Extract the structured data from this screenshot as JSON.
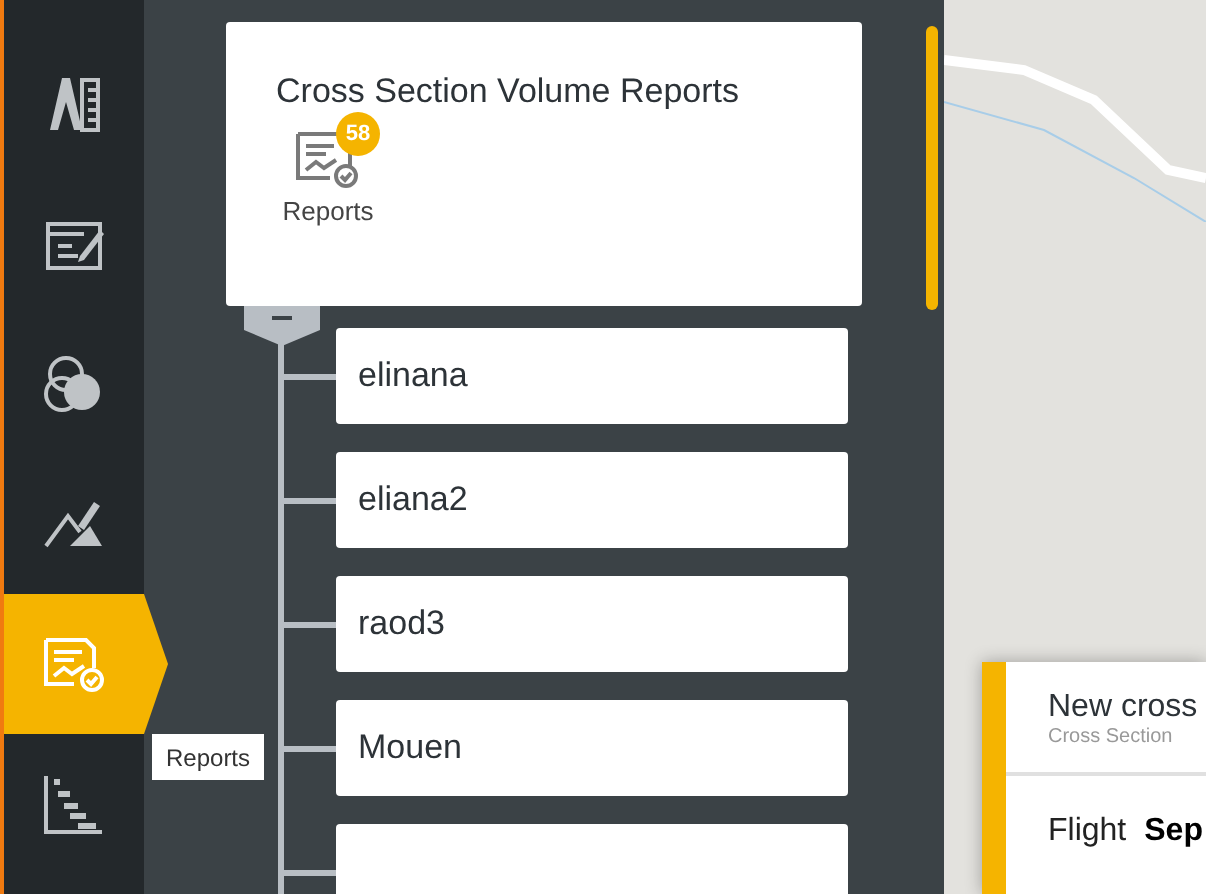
{
  "sidebar": {
    "items": [
      {
        "kind": "measure",
        "selected": false
      },
      {
        "kind": "annotate",
        "selected": false
      },
      {
        "kind": "layers",
        "selected": false
      },
      {
        "kind": "terrain",
        "selected": false
      },
      {
        "kind": "reports",
        "selected": true
      },
      {
        "kind": "timeline",
        "selected": false
      }
    ]
  },
  "tooltip": "Reports",
  "report_card": {
    "title": "Cross Section Volume Reports",
    "badge": "58",
    "label": "Reports"
  },
  "tree": {
    "expanded": true,
    "items": [
      {
        "name": "elinana"
      },
      {
        "name": "eliana2"
      },
      {
        "name": "raod3"
      },
      {
        "name": "Mouen"
      }
    ],
    "more_below": true
  },
  "map_card": {
    "title": "New cross",
    "subtitle": "Cross Section",
    "field_label": "Flight",
    "field_value": "Sep"
  }
}
